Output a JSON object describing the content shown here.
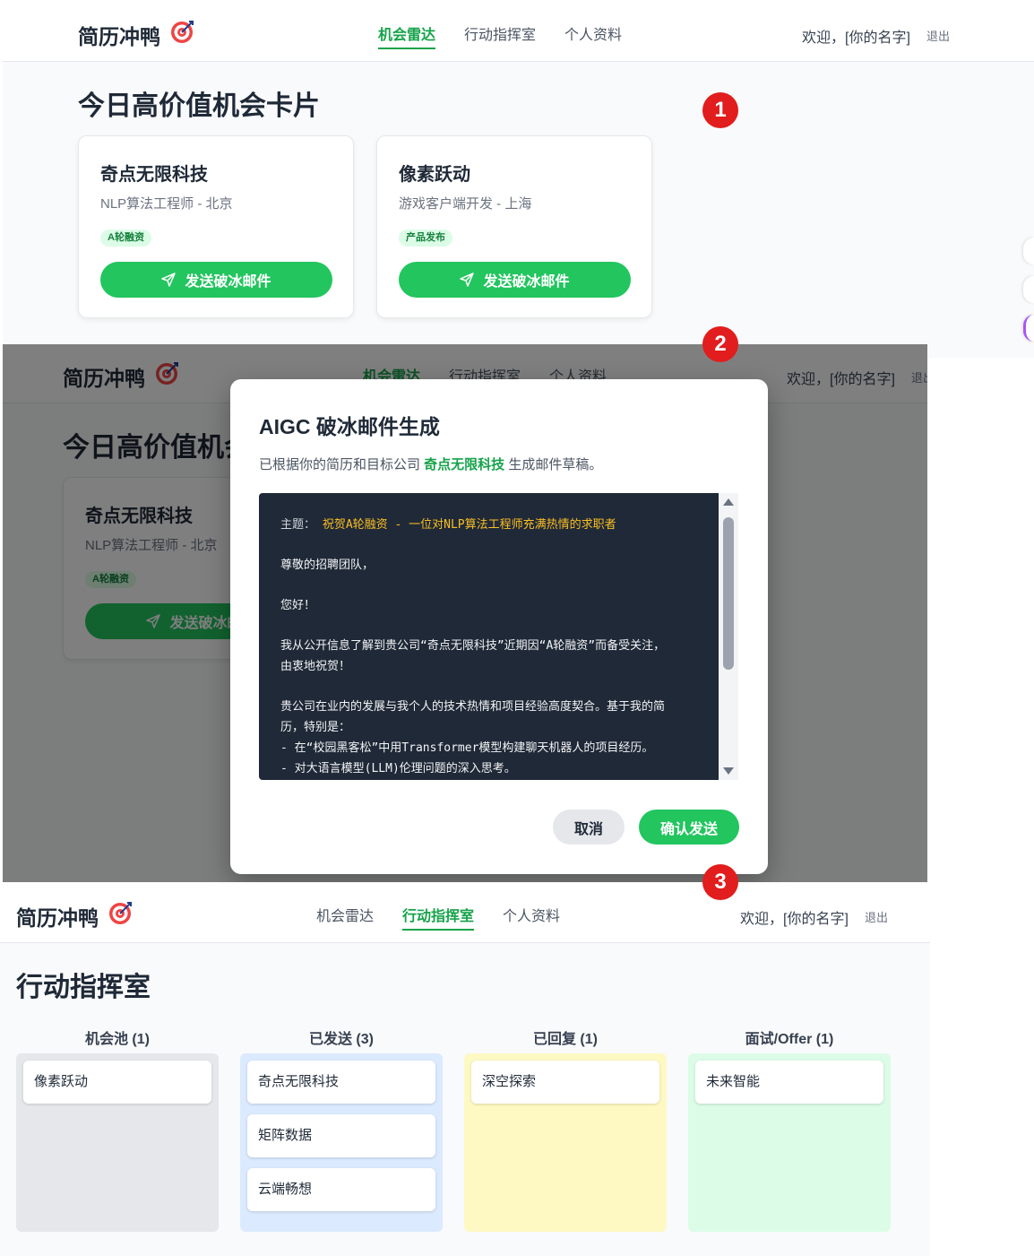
{
  "app": {
    "logo_text": "简历冲鸭",
    "logo_icon": "target-dart-icon",
    "nav": [
      "机会雷达",
      "行动指挥室",
      "个人资料"
    ],
    "welcome": "欢迎，[你的名字]",
    "logout": "退出"
  },
  "colors": {
    "brand_green": "#22c55e",
    "marker_red": "#e11d1d",
    "draft_bg": "#1f2937"
  },
  "step_markers": [
    "1",
    "2",
    "3"
  ],
  "panel1": {
    "active_tab": "机会雷达",
    "page_title": "今日高价值机会卡片",
    "cards": [
      {
        "company": "奇点无限科技",
        "role": "NLP算法工程师 - 北京",
        "tag": "A轮融资",
        "button": "发送破冰邮件"
      },
      {
        "company": "像素跃动",
        "role": "游戏客户端开发 - 上海",
        "tag": "产品发布",
        "button": "发送破冰邮件"
      }
    ]
  },
  "panel2": {
    "page_title": "今日高价值机会卡片",
    "background_card": {
      "company": "奇点无限科技",
      "role": "NLP算法工程师 - 北京",
      "tag": "A轮融资",
      "button": "发送破冰邮件"
    },
    "modal": {
      "title": "AIGC 破冰邮件生成",
      "desc_prefix": "已根据你的简历和目标公司 ",
      "desc_company": "奇点无限科技",
      "desc_suffix": " 生成邮件草稿。",
      "subject_label": "主题：",
      "subject_text": "祝贺A轮融资 - 一位对NLP算法工程师充满热情的求职者",
      "body": [
        "尊敬的招聘团队，",
        "",
        "您好！",
        "",
        "我从公开信息了解到贵公司“奇点无限科技”近期因“A轮融资”而备受关注，",
        "由衷地祝贺！",
        "",
        "贵公司在业内的发展与我个人的技术热情和项目经验高度契合。基于我的简",
        "历，特别是：",
        "- 在“校园黑客松”中用Transformer模型构建聊天机器人的项目经历。",
        "- 对大语言模型(LLM)伦理问题的深入思考。"
      ],
      "cancel": "取消",
      "confirm": "确认发送"
    }
  },
  "panel3": {
    "active_tab": "行动指挥室",
    "page_title": "行动指挥室",
    "columns": [
      {
        "title": "机会池 (1)",
        "color": "#e5e7eb",
        "items": [
          "像素跃动"
        ]
      },
      {
        "title": "已发送 (3)",
        "color": "#dbeafe",
        "items": [
          "奇点无限科技",
          "矩阵数据",
          "云端畅想"
        ]
      },
      {
        "title": "已回复 (1)",
        "color": "#fef9c3",
        "items": [
          "深空探索"
        ]
      },
      {
        "title": "面试/Offer (1)",
        "color": "#dcfce7",
        "items": [
          "未来智能"
        ]
      }
    ]
  }
}
